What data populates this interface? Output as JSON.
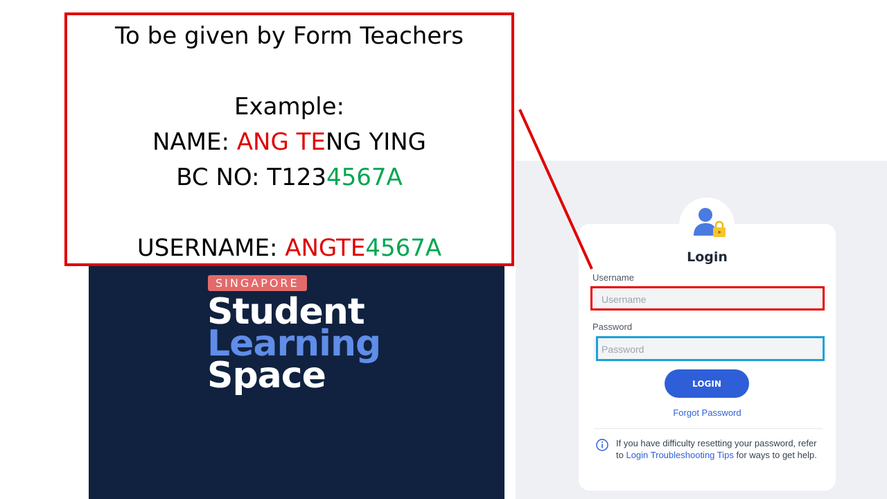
{
  "annotation": {
    "heading": "To be given by Form Teachers",
    "example_label": "Example:",
    "name_label": "NAME: ",
    "name_part_red": "ANG TE",
    "name_part_rest": "NG YING",
    "bc_label": "BC NO: T123",
    "bc_part_green": "4567A",
    "username_label": "USERNAME: ",
    "username_part_red": "ANGTE",
    "username_part_green": "4567A",
    "colors": {
      "border": "#e00000",
      "red": "#e00000",
      "green": "#00a650"
    }
  },
  "branding": {
    "badge": "SINGAPORE",
    "line1": "Student",
    "line2": "Learning",
    "line3": "Space",
    "colors": {
      "panel": "#10223f",
      "badge": "#e36a6a",
      "accent": "#5f8de8"
    }
  },
  "login": {
    "avatar_icon": "user-lock-icon",
    "title": "Login",
    "username_label": "Username",
    "username_placeholder": "Username",
    "password_label": "Password",
    "password_placeholder": "Password",
    "submit_label": "LOGIN",
    "forgot_label": "Forgot Password",
    "info_icon": "info-icon",
    "info_text_1": "If you have difficulty resetting your password, refer to ",
    "info_link": "Login Troubleshooting Tips",
    "info_text_2": " for ways to get help.",
    "colors": {
      "primary": "#2f5fd8",
      "highlight_username": "#e60000",
      "highlight_password": "#1ba1d9"
    }
  }
}
